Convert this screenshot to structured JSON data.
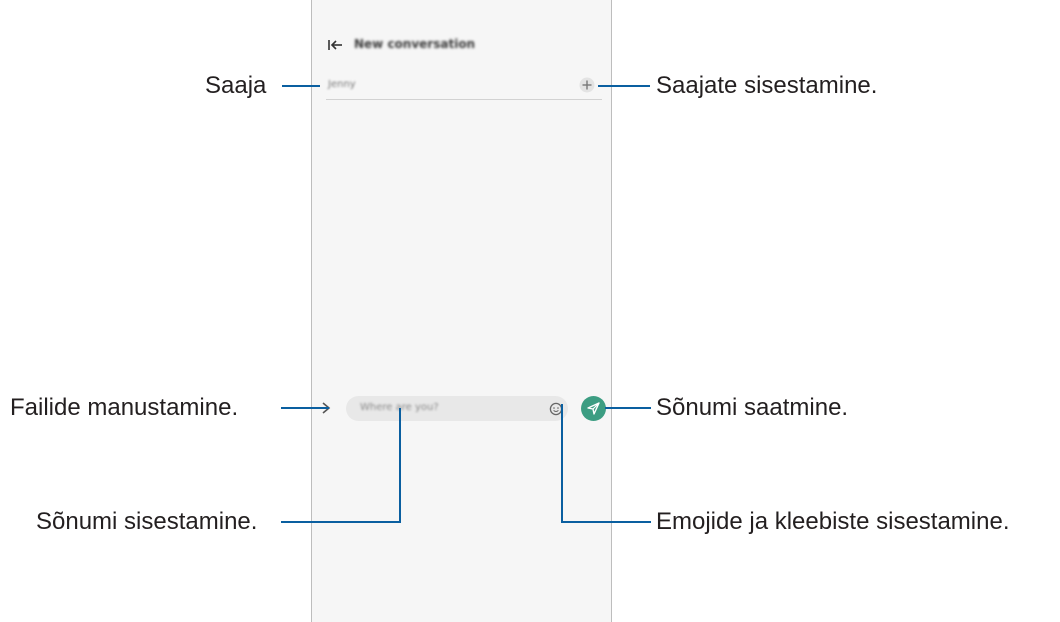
{
  "screen": {
    "app_title": "New conversation",
    "recipient_value": "Jenny",
    "message_placeholder": "Where are you?",
    "accent_color": "#3c9d82",
    "icons": [
      "back-arrow-icon",
      "plus-icon",
      "chevron-right-icon",
      "emoji-icon",
      "send-icon"
    ]
  },
  "callouts": {
    "recipient": "Saaja",
    "add_recipients": "Saajate sisestamine.",
    "enter_message": "Sõnumi sisestamine.",
    "emojis_stickers": "Emojide ja kleebiste sisestamine.",
    "attach_files": "Failide manustamine.",
    "send_message": "Sõnumi saatmine."
  }
}
